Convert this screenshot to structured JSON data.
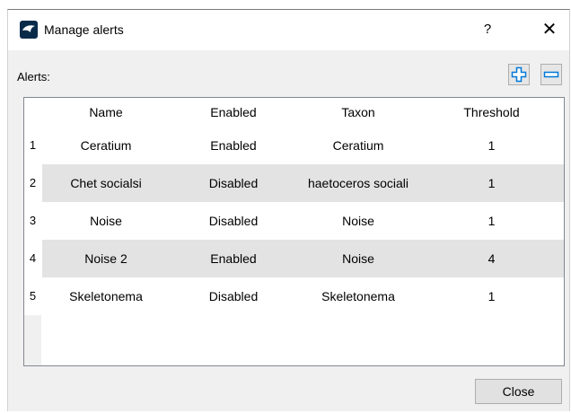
{
  "window": {
    "title": "Manage alerts",
    "help_label": "?",
    "close_label": "✕"
  },
  "toolbar": {
    "label": "Alerts:"
  },
  "table": {
    "columns": [
      "Name",
      "Enabled",
      "Taxon",
      "Threshold"
    ],
    "rows": [
      {
        "num": "1",
        "name": "Ceratium",
        "enabled": "Enabled",
        "taxon": "Ceratium",
        "threshold": "1"
      },
      {
        "num": "2",
        "name": "Chet socialsi",
        "enabled": "Disabled",
        "taxon": "haetoceros sociali",
        "threshold": "1"
      },
      {
        "num": "3",
        "name": "Noise",
        "enabled": "Disabled",
        "taxon": "Noise",
        "threshold": "1"
      },
      {
        "num": "4",
        "name": "Noise 2",
        "enabled": "Enabled",
        "taxon": "Noise",
        "threshold": "4"
      },
      {
        "num": "5",
        "name": "Skeletonema",
        "enabled": "Disabled",
        "taxon": "Skeletonema",
        "threshold": "1"
      }
    ]
  },
  "footer": {
    "close_button": "Close"
  },
  "colors": {
    "accent": "#0078d7",
    "alt_row": "#e3e3e3"
  }
}
